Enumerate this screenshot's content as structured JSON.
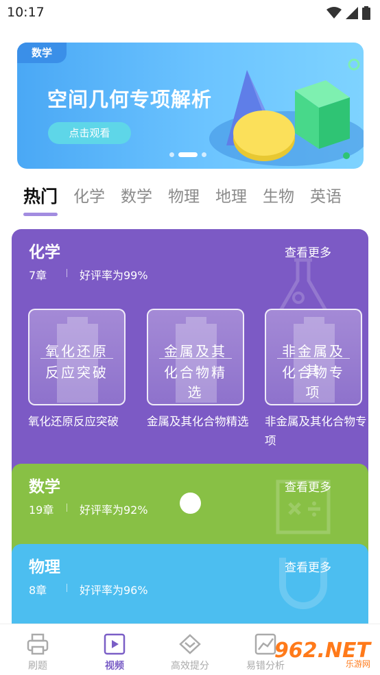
{
  "status_bar": {
    "time": "10:17"
  },
  "banner": {
    "tag": "数学",
    "title": "空间几何专项解析",
    "button": "点击观看"
  },
  "tabs": [
    {
      "label": "热门",
      "active": true
    },
    {
      "label": "化学"
    },
    {
      "label": "数学"
    },
    {
      "label": "物理"
    },
    {
      "label": "地理"
    },
    {
      "label": "生物"
    },
    {
      "label": "英语"
    }
  ],
  "cards": {
    "chemistry": {
      "name": "化学",
      "chapters": "7章",
      "rating": "好评率为99%",
      "more": "查看更多",
      "courses": [
        {
          "thumb_l1": "氧化还原",
          "thumb_l2": "反应突破",
          "title": "氧化还原反应突破"
        },
        {
          "thumb_l1": "金属及其",
          "thumb_l2": "化合物精选",
          "title": "金属及其化合物精选"
        },
        {
          "thumb_l1": "非金属及其",
          "thumb_l2": "化合物专项",
          "title": "非金属及其化合物专项"
        }
      ]
    },
    "math": {
      "name": "数学",
      "chapters": "19章",
      "rating": "好评率为92%",
      "more": "查看更多"
    },
    "physics": {
      "name": "物理",
      "chapters": "8章",
      "rating": "好评率为96%",
      "more": "查看更多"
    }
  },
  "bottom_nav": [
    {
      "label": "刷题",
      "icon": "printer-icon"
    },
    {
      "label": "视频",
      "icon": "video-icon",
      "active": true
    },
    {
      "label": "高效提分",
      "icon": "diamond-icon"
    },
    {
      "label": "易错分析",
      "icon": "chart-icon"
    }
  ],
  "watermark": {
    "text": "962.NET",
    "sub": "乐游网"
  }
}
